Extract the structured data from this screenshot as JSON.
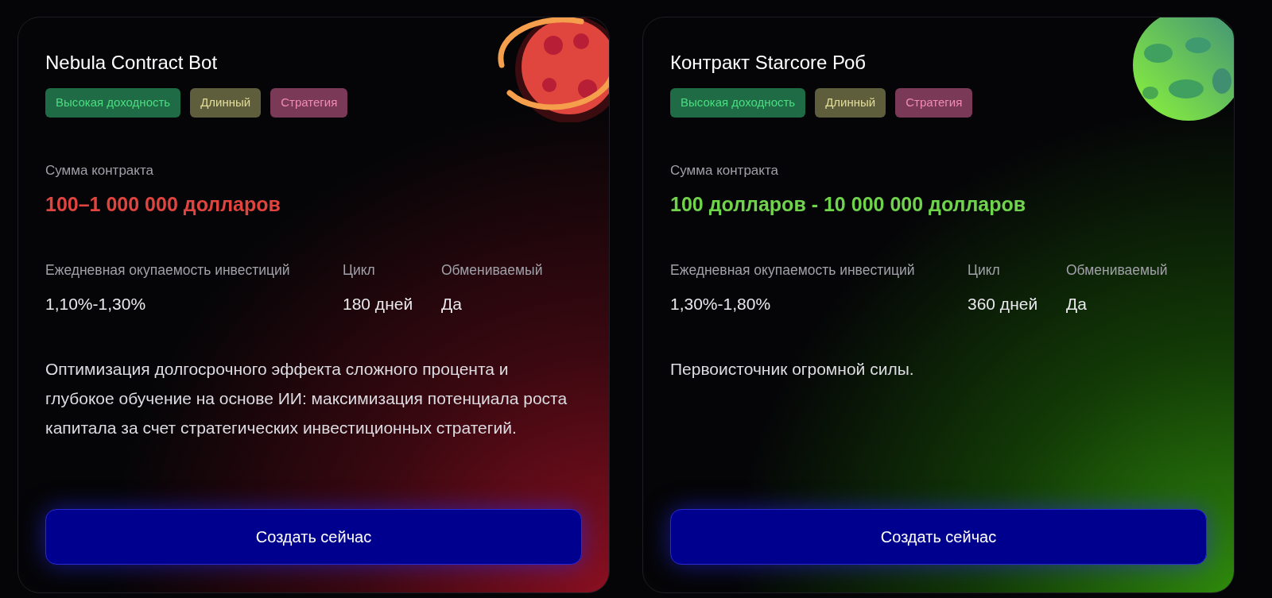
{
  "cards": [
    {
      "title": "Nebula Contract Bot",
      "kind": "ringed",
      "color": "#e0443e",
      "tags": [
        {
          "label": "Высокая доходность",
          "color": "#1f6b45"
        },
        {
          "label": "Длинный",
          "color": "#5e5e3c"
        },
        {
          "label": "Стратегия",
          "color": "#7a3a57"
        }
      ],
      "amount_label": "Сумма контракта",
      "amount": "100–1 000 000 долларов",
      "stats": [
        {
          "label": "Ежедневная окупаемость инвестиций",
          "value": "1,10%-1,30%"
        },
        {
          "label": "Цикл",
          "value": "180 дней"
        },
        {
          "label": "Обмениваемый",
          "value": "Да"
        }
      ],
      "description": "Оптимизация долгосрочного эффекта сложного процента и глубокое обучение на основе ИИ: максимизация потенциала роста капитала за счет стратегических инвестиционных стратегий.",
      "button": "Создать сейчас"
    },
    {
      "title": "Контракт Starcore Роб",
      "kind": "spotted",
      "color": "#6fd44c",
      "tags": [
        {
          "label": "Высокая доходность",
          "color": "#1f6b45"
        },
        {
          "label": "Длинный",
          "color": "#5e5e3c"
        },
        {
          "label": "Стратегия",
          "color": "#7a3a57"
        }
      ],
      "amount_label": "Сумма контракта",
      "amount": "100 долларов - 10 000 000 долларов",
      "stats": [
        {
          "label": "Ежедневная окупаемость инвестиций",
          "value": "1,30%-1,80%"
        },
        {
          "label": "Цикл",
          "value": "360 дней"
        },
        {
          "label": "Обмениваемый",
          "value": "Да"
        }
      ],
      "description": "Первоисточник огромной силы.",
      "button": "Создать сейчас"
    }
  ]
}
